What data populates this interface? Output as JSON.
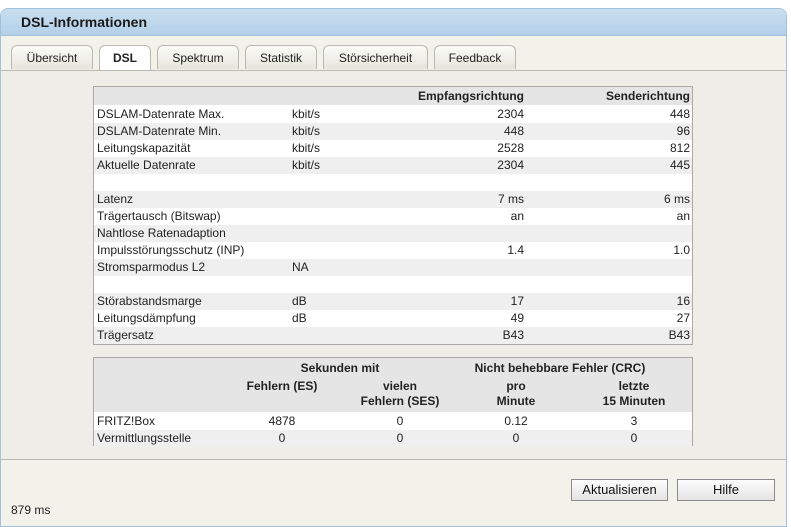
{
  "window": {
    "title": "DSL-Informationen"
  },
  "tabs": [
    {
      "label": "Übersicht"
    },
    {
      "label": "DSL"
    },
    {
      "label": "Spektrum"
    },
    {
      "label": "Statistik"
    },
    {
      "label": "Störsicherheit"
    },
    {
      "label": "Feedback"
    }
  ],
  "active_tab": "DSL",
  "table1": {
    "headers": {
      "downstream": "Empfangsrichtung",
      "upstream": "Senderichtung"
    },
    "rows": [
      {
        "label": "DSLAM-Datenrate Max.",
        "unit": "kbit/s",
        "down": "2304",
        "up": "448"
      },
      {
        "label": "DSLAM-Datenrate Min.",
        "unit": "kbit/s",
        "down": "448",
        "up": "96"
      },
      {
        "label": "Leitungskapazität",
        "unit": "kbit/s",
        "down": "2528",
        "up": "812"
      },
      {
        "label": "Aktuelle Datenrate",
        "unit": "kbit/s",
        "down": "2304",
        "up": "445"
      },
      {
        "label": "",
        "unit": "",
        "down": "",
        "up": ""
      },
      {
        "label": "Latenz",
        "unit": "",
        "down": "7 ms",
        "up": "6 ms"
      },
      {
        "label": "Trägertausch (Bitswap)",
        "unit": "",
        "down": "an",
        "up": "an"
      },
      {
        "label": "Nahtlose Ratenadaption",
        "unit": "",
        "down": "",
        "up": ""
      },
      {
        "label": "Impulsstörungsschutz (INP)",
        "unit": "",
        "down": "1.4",
        "up": "1.0"
      },
      {
        "label": "Stromsparmodus L2",
        "unit": "NA",
        "down": "",
        "up": ""
      },
      {
        "label": "",
        "unit": "",
        "down": "",
        "up": ""
      },
      {
        "label": "Störabstandsmarge",
        "unit": "dB",
        "down": "17",
        "up": "16"
      },
      {
        "label": "Leitungsdämpfung",
        "unit": "dB",
        "down": "49",
        "up": "27"
      },
      {
        "label": "Trägersatz",
        "unit": "",
        "down": "B43",
        "up": "B43"
      }
    ]
  },
  "table2": {
    "group1": "Sekunden mit",
    "group2": "Nicht behebbare Fehler (CRC)",
    "col_es": "Fehlern (ES)",
    "col_ses_1": "vielen",
    "col_ses_2": "Fehlern (SES)",
    "col_pm_1": "pro",
    "col_pm_2": "Minute",
    "col_15_1": "letzte",
    "col_15_2": "15 Minuten",
    "rows": [
      {
        "label": "FRITZ!Box",
        "es": "4878",
        "ses": "0",
        "pm": "0.12",
        "m15": "3"
      },
      {
        "label": "Vermittlungsstelle",
        "es": "0",
        "ses": "0",
        "pm": "0",
        "m15": "0"
      }
    ]
  },
  "buttons": {
    "refresh": "Aktualisieren",
    "help": "Hilfe"
  },
  "status": {
    "load_time": "879 ms"
  }
}
